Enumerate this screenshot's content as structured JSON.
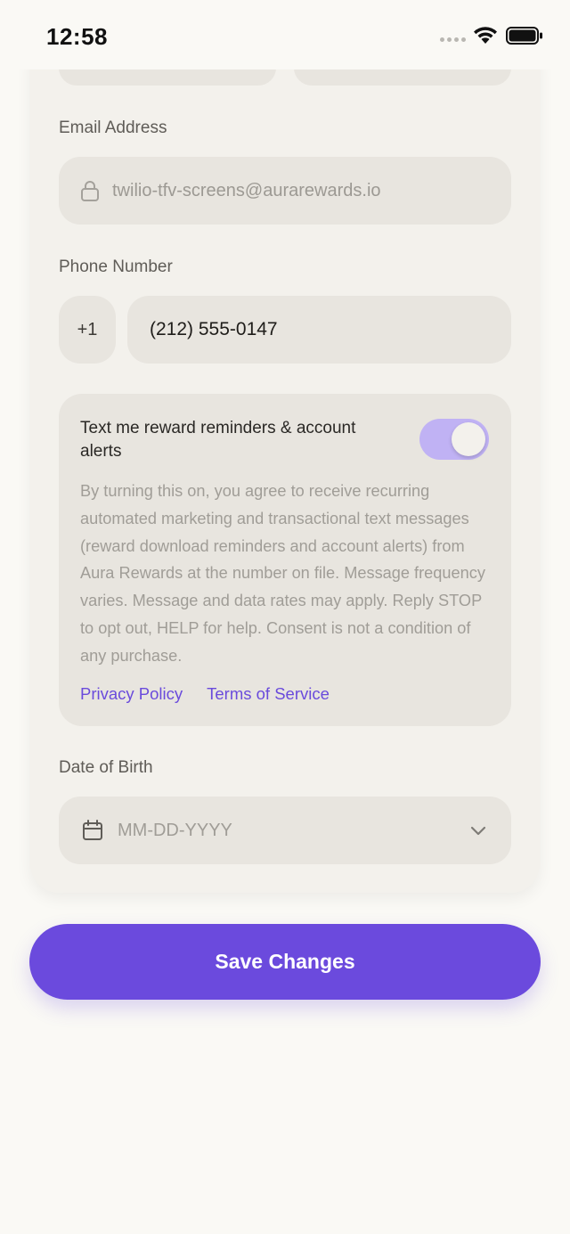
{
  "status_bar": {
    "time": "12:58"
  },
  "form": {
    "email_label": "Email Address",
    "email_value": "twilio-tfv-screens@aurarewards.io",
    "phone_label": "Phone Number",
    "country_code": "+1",
    "phone_value": "(212) 555-0147",
    "dob_label": "Date of Birth",
    "dob_placeholder": "MM-DD-YYYY"
  },
  "sms_consent": {
    "title": "Text me reward reminders & account alerts",
    "toggle_on": true,
    "body": "By turning this on, you agree to receive recurring automated marketing and transactional text messages (reward download reminders and account alerts) from Aura Rewards at the number on file. Message frequency varies. Message and data rates may apply. Reply STOP to opt out, HELP for help. Consent is not a condition of any purchase.",
    "privacy_link": "Privacy Policy",
    "terms_link": "Terms of Service"
  },
  "actions": {
    "save_label": "Save Changes"
  },
  "colors": {
    "accent": "#6B4ADD",
    "toggle_track": "#C0B2F4",
    "link": "#6A4BDC",
    "field_bg": "#E8E5DF",
    "card_bg": "#F3F1EC",
    "page_bg": "#FAF9F5"
  },
  "icons": {
    "lock": "lock-icon",
    "calendar": "calendar-icon",
    "chevron": "chevron-down-icon",
    "wifi": "wifi-icon",
    "battery": "battery-icon"
  }
}
